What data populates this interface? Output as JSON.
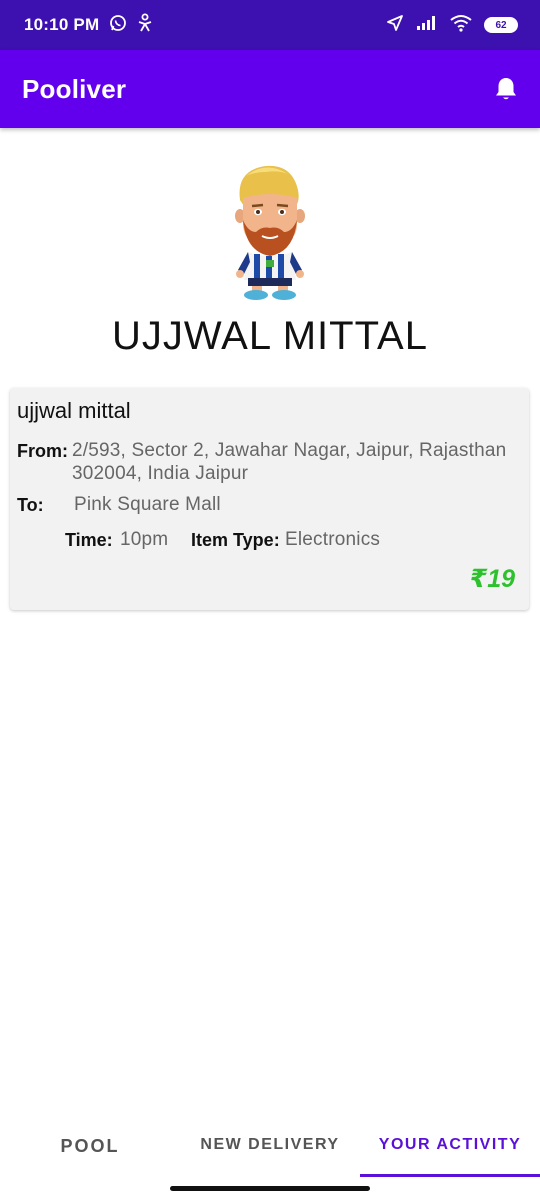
{
  "status_bar": {
    "time": "10:10 PM",
    "battery": "62",
    "icons": [
      "whatsapp-icon",
      "accessibility-icon",
      "location-arrow-icon",
      "signal-icon",
      "wifi-icon",
      "battery-icon"
    ]
  },
  "app_bar": {
    "title": "Pooliver",
    "notification_icon": "bell-icon"
  },
  "profile": {
    "name": "UJJWAL MITTAL",
    "avatar": "footballer-avatar"
  },
  "delivery_card": {
    "sender_name": "ujjwal mittal",
    "from_label": "From:",
    "from_line1": "2/593, Sector 2, Jawahar Nagar, Jaipur, Rajasthan",
    "from_line2": "302004, India Jaipur",
    "to_label": "To:",
    "to_value": "Pink Square Mall",
    "time_label": "Time:",
    "time_value": "10pm",
    "item_type_label": "Item Type:",
    "item_type_value": "Electronics",
    "price": "₹19"
  },
  "bottom_nav": {
    "tabs": [
      {
        "label": "POOL"
      },
      {
        "label": "NEW DELIVERY"
      },
      {
        "label": "YOUR ACTIVITY"
      }
    ],
    "active_tab": "YOUR ACTIVITY"
  },
  "colors": {
    "status_bar": "#3d10b0",
    "app_bar": "#6200ee",
    "accent": "#5a10d8",
    "price": "#2ec12e",
    "card_bg": "#f2f2f2"
  }
}
